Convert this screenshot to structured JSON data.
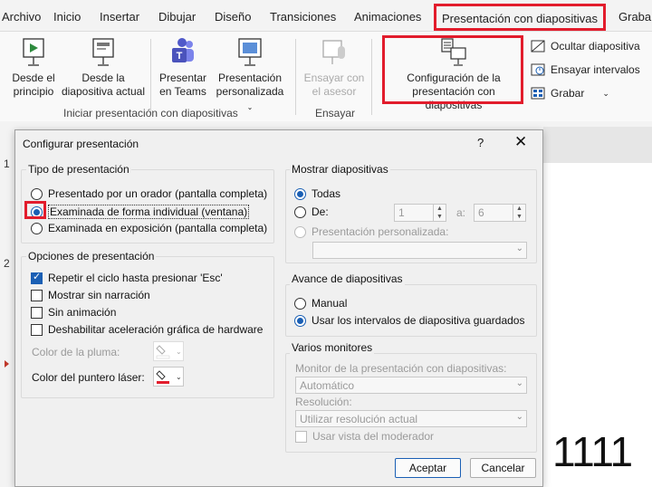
{
  "ribbon_tabs": [
    "Archivo",
    "Inicio",
    "Insertar",
    "Dibujar",
    "Diseño",
    "Transiciones",
    "Animaciones",
    "Presentación con diapositivas",
    "Graba"
  ],
  "ribbon": {
    "from_start": "Desde el principio",
    "from_start_l1": "Desde el",
    "from_start_l2": "principio",
    "from_current_l1": "Desde la",
    "from_current_l2": "diapositiva actual",
    "teams_l1": "Presentar",
    "teams_l2": "en Teams",
    "custom_l1": "Presentación",
    "custom_l2": "personalizada",
    "rehearse_presenter_l1": "Ensayar con",
    "rehearse_presenter_l2": "el asesor",
    "setup_l1": "Configuración de la",
    "setup_l2": "presentación con diapositivas",
    "hide_slide": "Ocultar diapositiva",
    "rehearse_timings": "Ensayar intervalos",
    "record": "Grabar",
    "group_start": "Iniciar presentación con diapositivas",
    "group_rehearse": "Ensayar"
  },
  "thumbnails": [
    "1",
    "2"
  ],
  "slide": {
    "text": "1111"
  },
  "dialog": {
    "title": "Configurar presentación",
    "help": "?",
    "close": "✕",
    "type_group": "Tipo de presentación",
    "type_options": [
      "Presentado por un orador (pantalla completa)",
      "Examinada de forma individual (ventana)",
      "Examinada en exposición (pantalla completa)"
    ],
    "type_selected_index": 1,
    "options_group": "Opciones de presentación",
    "options": [
      {
        "label": "Repetir el ciclo hasta presionar 'Esc'",
        "checked": true
      },
      {
        "label": "Mostrar sin narración",
        "checked": false
      },
      {
        "label": "Sin animación",
        "checked": false
      },
      {
        "label": "Deshabilitar aceleración gráfica de hardware",
        "checked": false
      }
    ],
    "pen_color_label": "Color de la pluma:",
    "laser_color_label": "Color del puntero láser:",
    "laser_color": "#e21c2c",
    "show_group": "Mostrar diapositivas",
    "show_all": "Todas",
    "show_from": "De:",
    "from_value": "1",
    "to_label": "a:",
    "to_value": "6",
    "custom_show": "Presentación personalizada:",
    "advance_group": "Avance de diapositivas",
    "advance_manual": "Manual",
    "advance_timings": "Usar los intervalos de diapositiva guardados",
    "monitors_group": "Varios monitores",
    "monitor_label": "Monitor de la presentación con diapositivas:",
    "monitor_value": "Automático",
    "resolution_label": "Resolución:",
    "resolution_value": "Utilizar resolución actual",
    "presenter_view": "Usar vista del moderador",
    "ok": "Aceptar",
    "cancel": "Cancelar"
  },
  "colors": {
    "highlight": "#e21c2c",
    "accent": "#1a5fb4"
  }
}
